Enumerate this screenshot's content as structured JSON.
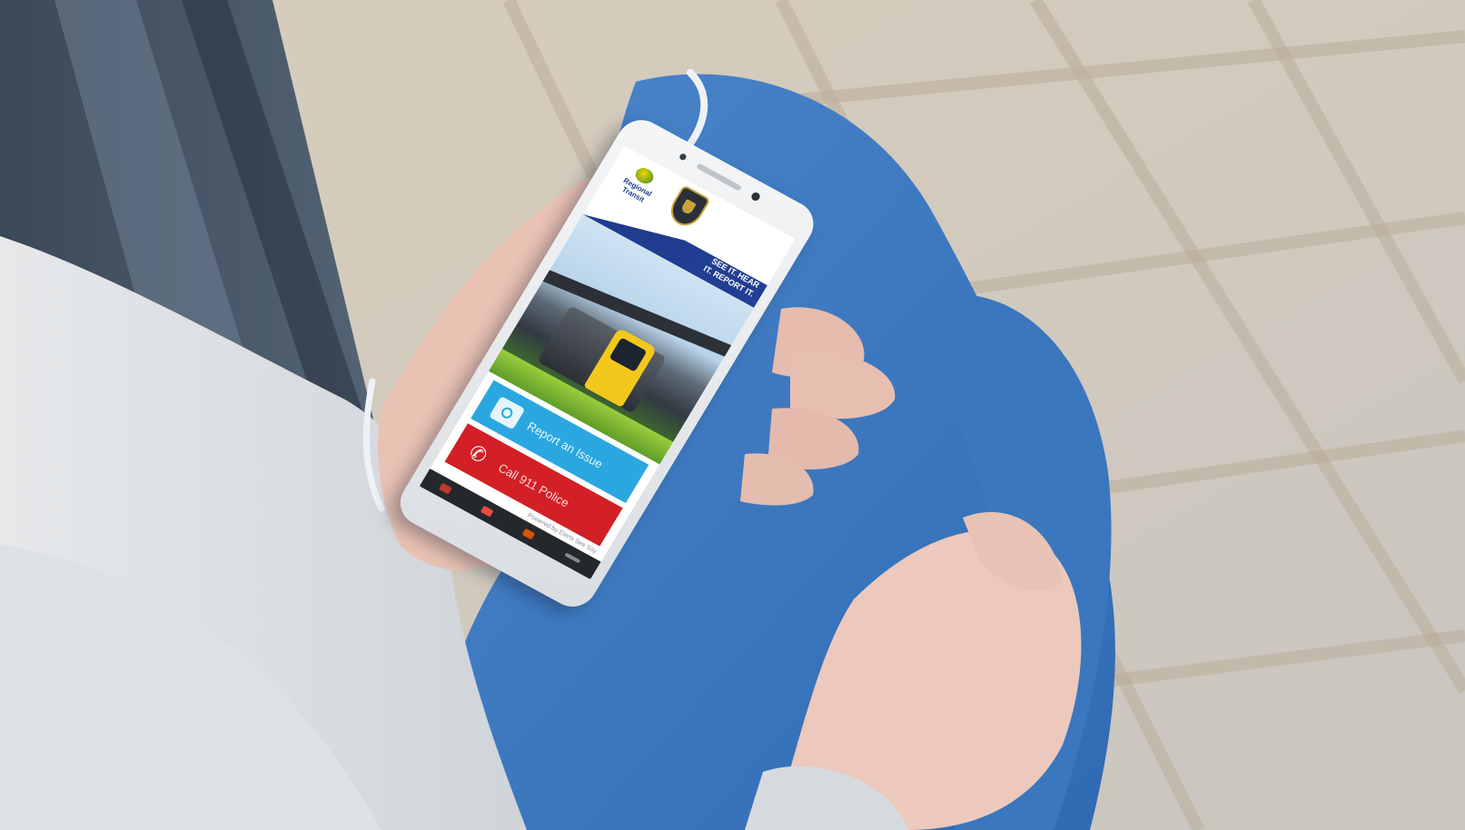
{
  "app": {
    "logo_text": "Regional Transit",
    "slogan": "SEE IT. HEAR IT. REPORT IT.",
    "report_button_label": "Report an Issue",
    "call_button_label": "Call 911 Police",
    "footer_note": "Powered by Elerts See Say",
    "tab_bar": [
      "home",
      "phone",
      "alert",
      "more"
    ]
  },
  "colors": {
    "header_blue": "#1e3b8c",
    "report_blue": "#2aa7e0",
    "call_red": "#d31f26",
    "denim": "#3f7fc8"
  },
  "icons": {
    "report": "camera-icon",
    "call": "phone-icon"
  }
}
